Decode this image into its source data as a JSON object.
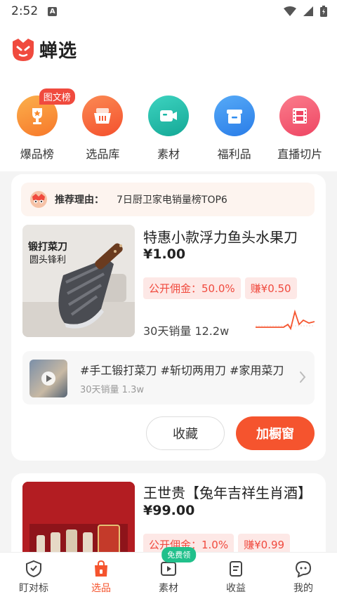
{
  "status_bar": {
    "time": "2:52",
    "notification_letter": "A"
  },
  "app": {
    "name": "蝉选"
  },
  "categories": [
    {
      "label": "爆品榜",
      "badge": "图文榜",
      "icon": "trophy-icon",
      "color": "#f98a2b"
    },
    {
      "label": "选品库",
      "icon": "basket-icon",
      "color": "#f65c33"
    },
    {
      "label": "素材",
      "icon": "video-camera-icon",
      "color": "#19b7a5"
    },
    {
      "label": "福利品",
      "icon": "gift-box-icon",
      "color": "#2d8cf0"
    },
    {
      "label": "直播切片",
      "icon": "film-icon",
      "color": "#f0566e"
    }
  ],
  "product1": {
    "reason_title": "推荐理由：",
    "reason_text": "7日厨卫家电销量榜TOP6",
    "title": "特惠小款浮力鱼头水果刀",
    "price": "¥1.00",
    "commission_tag": "公开佣金：50.0%",
    "earn_tag": "赚¥0.50",
    "sales": "30天销量 12.2w",
    "image_caption1": "锻打菜刀",
    "image_caption2": "圆头锋利",
    "video": {
      "title": "#手工锻打菜刀 #斩切两用刀 #家用菜刀",
      "sales": "30天销量 1.3w"
    },
    "fav_button": "收藏",
    "add_button": "加橱窗"
  },
  "product2": {
    "title": "王世贵【兔年吉祥生肖酒】",
    "price": "¥99.00",
    "commission_tag": "公开佣金：1.0%",
    "earn_tag": "赚¥0.99"
  },
  "bottom_nav": [
    {
      "label": "盯对标",
      "icon": "shield-icon"
    },
    {
      "label": "选品",
      "icon": "shopping-bag-icon",
      "active": true
    },
    {
      "label": "素材",
      "icon": "play-icon",
      "badge": "免费领"
    },
    {
      "label": "收益",
      "icon": "document-icon"
    },
    {
      "label": "我的",
      "icon": "chat-face-icon"
    }
  ],
  "colors": {
    "accent": "#f5542e",
    "tag_red": "#f04a3e",
    "badge_green": "#21c08b"
  }
}
